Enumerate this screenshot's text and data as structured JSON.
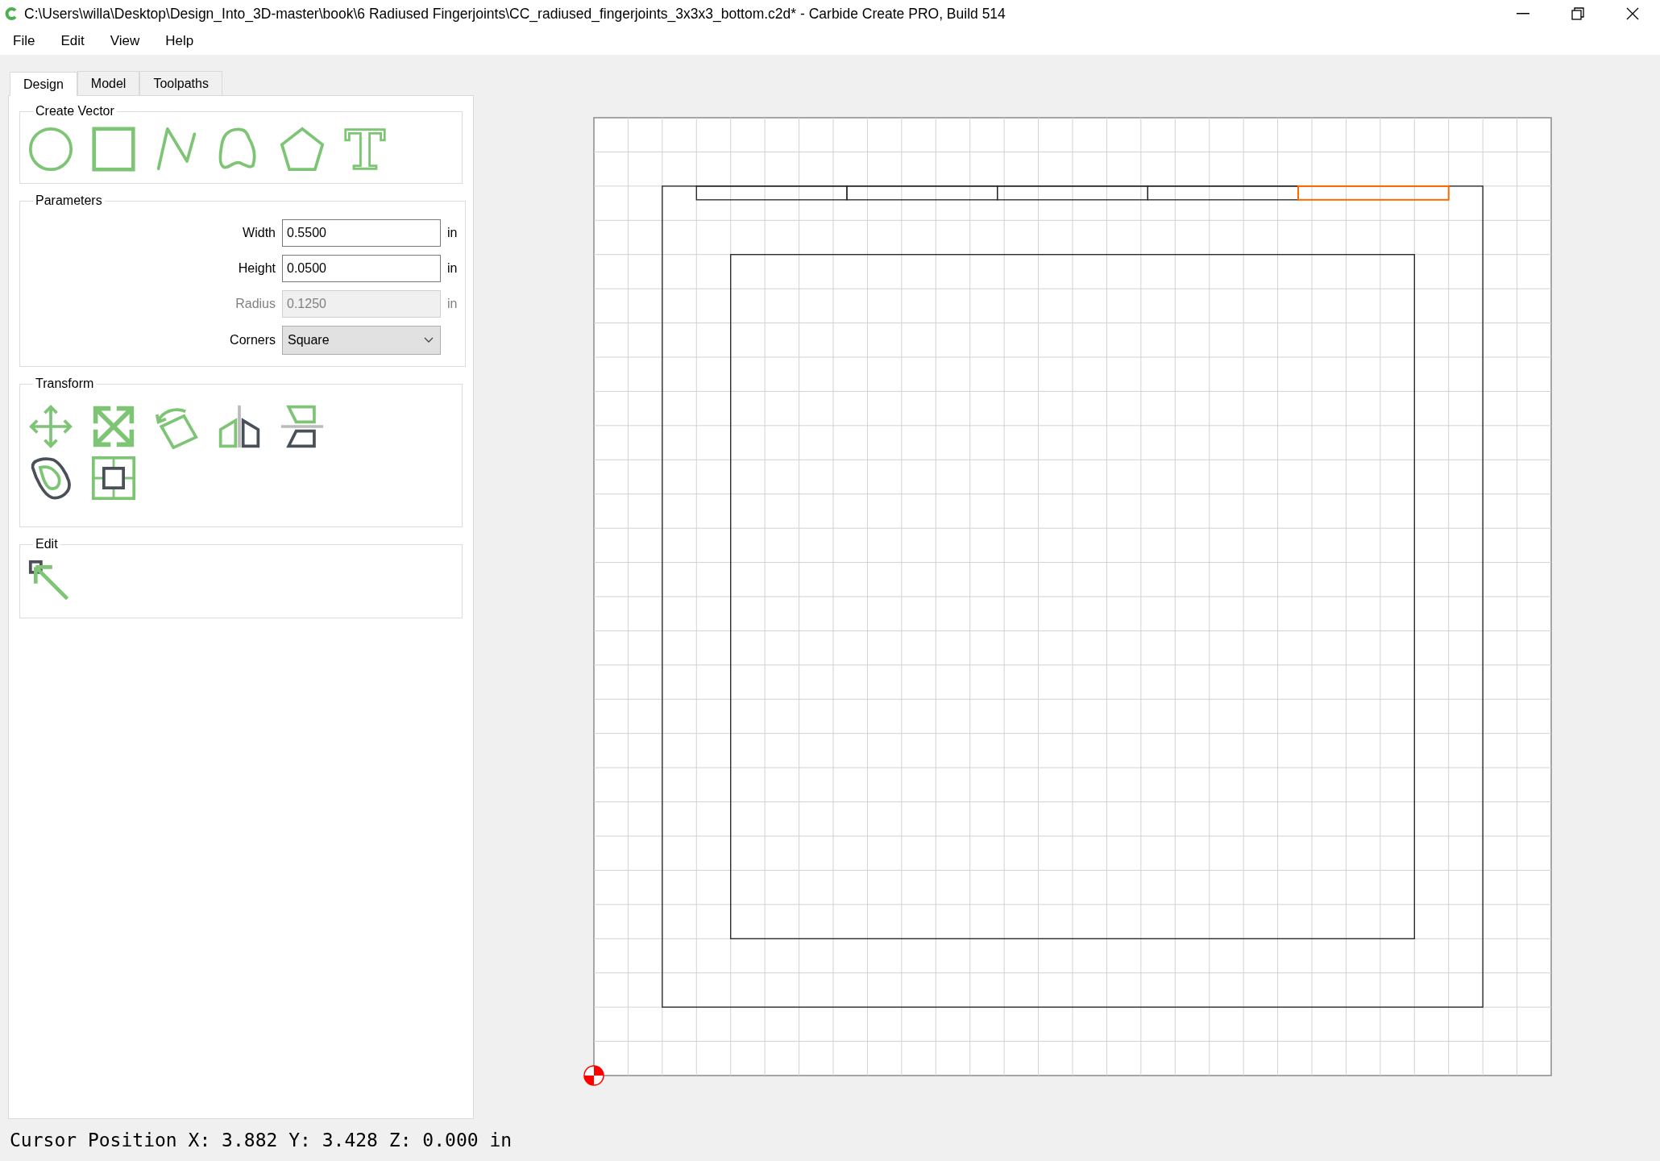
{
  "window": {
    "title": "C:\\Users\\willa\\Desktop\\Design_Into_3D-master\\book\\6 Radiused Fingerjoints\\CC_radiused_fingerjoints_3x3x3_bottom.c2d* - Carbide Create PRO, Build 514"
  },
  "menu": [
    "File",
    "Edit",
    "View",
    "Help"
  ],
  "tabs": [
    {
      "label": "Design",
      "selected": true
    },
    {
      "label": "Model",
      "selected": false
    },
    {
      "label": "Toolpaths",
      "selected": false
    }
  ],
  "panel": {
    "create_vector": {
      "title": "Create Vector"
    },
    "parameters": {
      "title": "Parameters",
      "fields": [
        {
          "label": "Width",
          "value": "0.5500",
          "unit": "in",
          "disabled": false
        },
        {
          "label": "Height",
          "value": "0.0500",
          "unit": "in",
          "disabled": false
        },
        {
          "label": "Radius",
          "value": "0.1250",
          "unit": "in",
          "disabled": true
        }
      ],
      "corners": {
        "label": "Corners",
        "value": "Square"
      }
    },
    "transform": {
      "title": "Transform"
    },
    "edit": {
      "title": "Edit"
    }
  },
  "canvas": {
    "fingers": [
      {
        "selected": false
      },
      {
        "selected": false
      },
      {
        "selected": false
      },
      {
        "selected": false
      },
      {
        "selected": true
      }
    ]
  },
  "status_bar": "Cursor Position X: 3.882 Y: 3.428 Z: 0.000 in"
}
